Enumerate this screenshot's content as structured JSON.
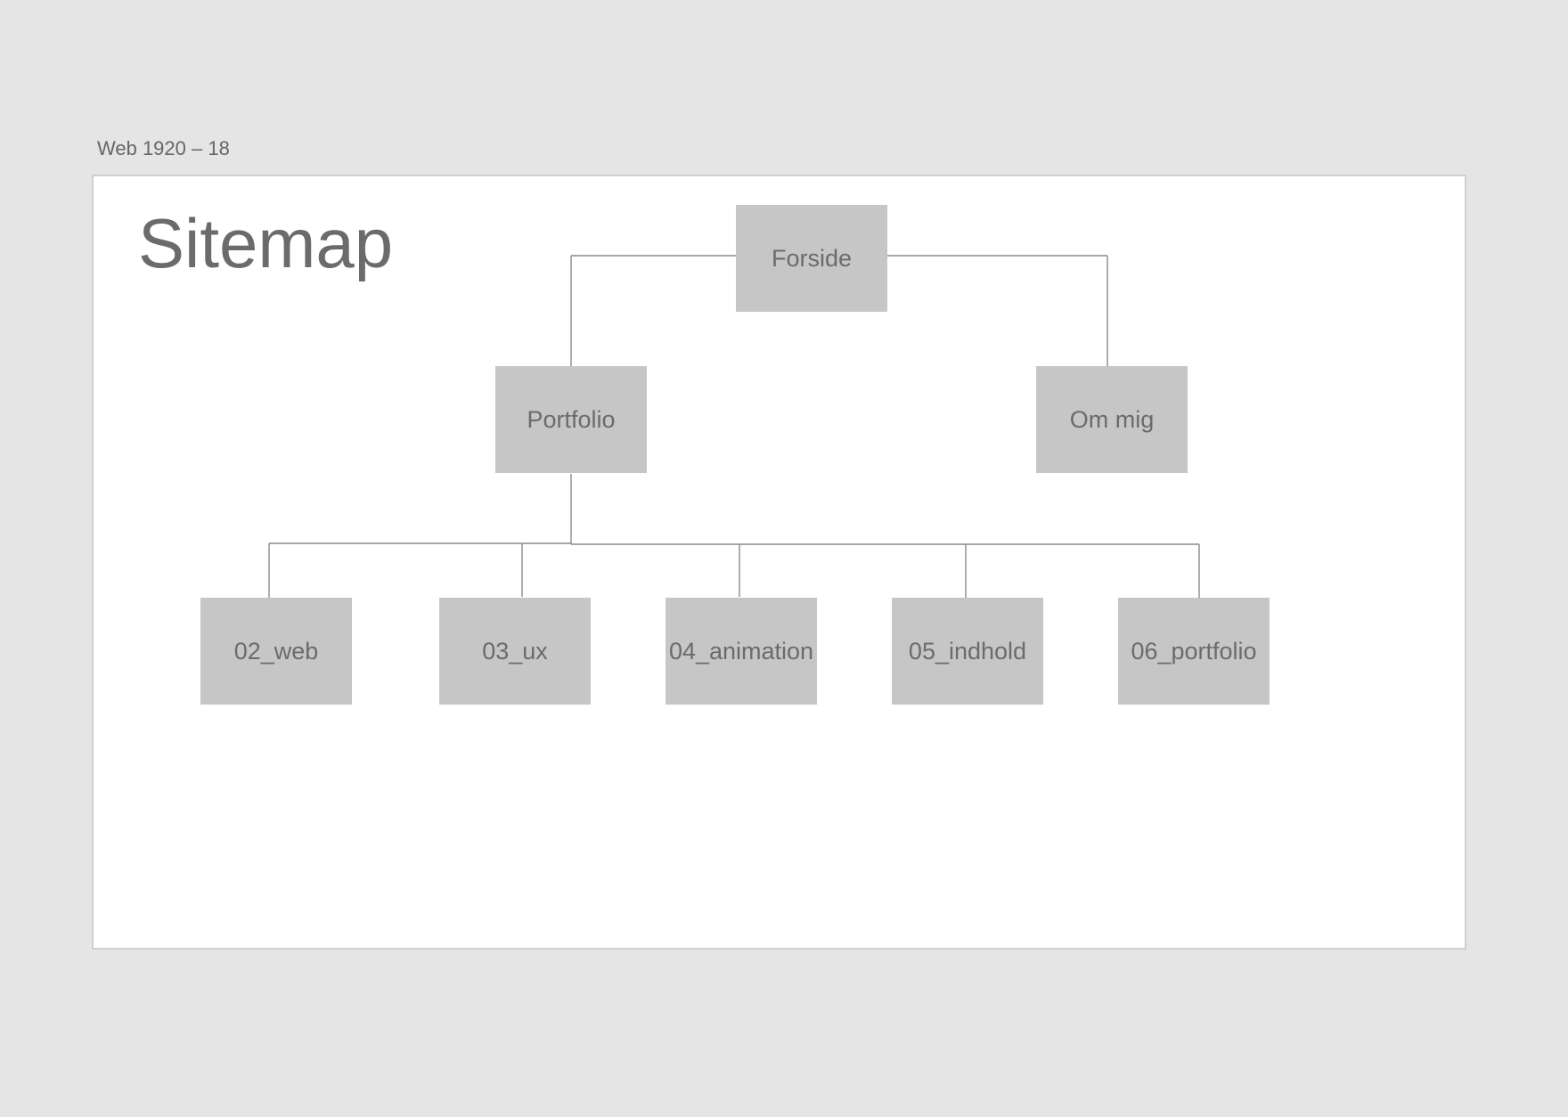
{
  "frame": {
    "label": "Web 1920 – 18"
  },
  "diagram": {
    "title": "Sitemap",
    "nodes": {
      "root": "Forside",
      "portfolio": "Portfolio",
      "about": "Om mig",
      "web": "02_web",
      "ux": "03_ux",
      "animation": "04_animation",
      "content": "05_indhold",
      "portfolio_page": "06_portfolio"
    },
    "edges": [
      [
        "Forside",
        "Portfolio"
      ],
      [
        "Forside",
        "Om mig"
      ],
      [
        "Portfolio",
        "02_web"
      ],
      [
        "Portfolio",
        "03_ux"
      ],
      [
        "Portfolio",
        "04_animation"
      ],
      [
        "Portfolio",
        "05_indhold"
      ],
      [
        "Portfolio",
        "06_portfolio"
      ]
    ]
  },
  "colors": {
    "background": "#e5e5e5",
    "artboard": "#ffffff",
    "node_fill": "#c6c6c6",
    "text": "#6b6b6b",
    "connector": "#8a8a8a"
  }
}
